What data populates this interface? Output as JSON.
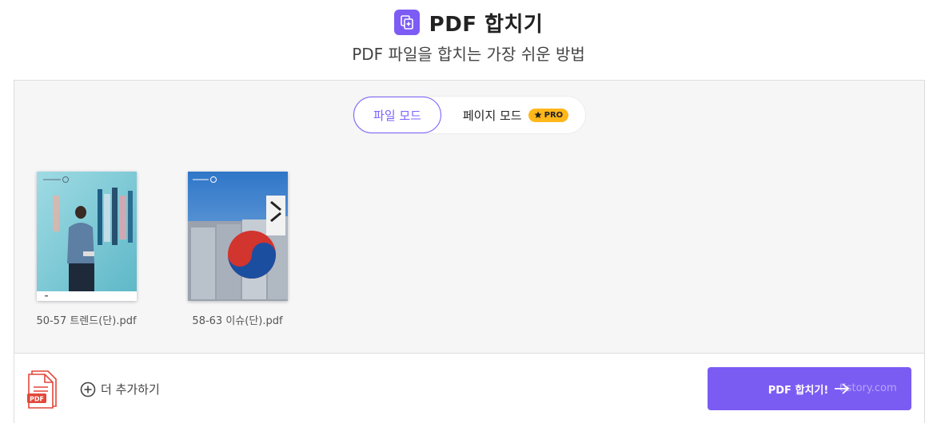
{
  "header": {
    "title": "PDF 합치기",
    "subtitle": "PDF 파일을 합치는 가장 쉬운 방법"
  },
  "mode_toggle": {
    "file_mode": "파일 모드",
    "page_mode": "페이지 모드",
    "pro_badge": "PRO"
  },
  "files": [
    {
      "name": "50-57 트렌드(단).pdf"
    },
    {
      "name": "58-63 이슈(단).pdf"
    }
  ],
  "bottom": {
    "doc_icon_label": "PDF",
    "add_more": "더 추가하기",
    "merge_button": "PDF 합치기!",
    "watermark": "tistory.com"
  },
  "colors": {
    "accent": "#7b5cf3",
    "pro_badge": "#ffb71a",
    "pdf_red": "#e2473a"
  },
  "icons": [
    "merge-pdf-icon",
    "star-icon",
    "pdf-document-icon",
    "plus-circle-icon",
    "arrow-right-icon"
  ]
}
